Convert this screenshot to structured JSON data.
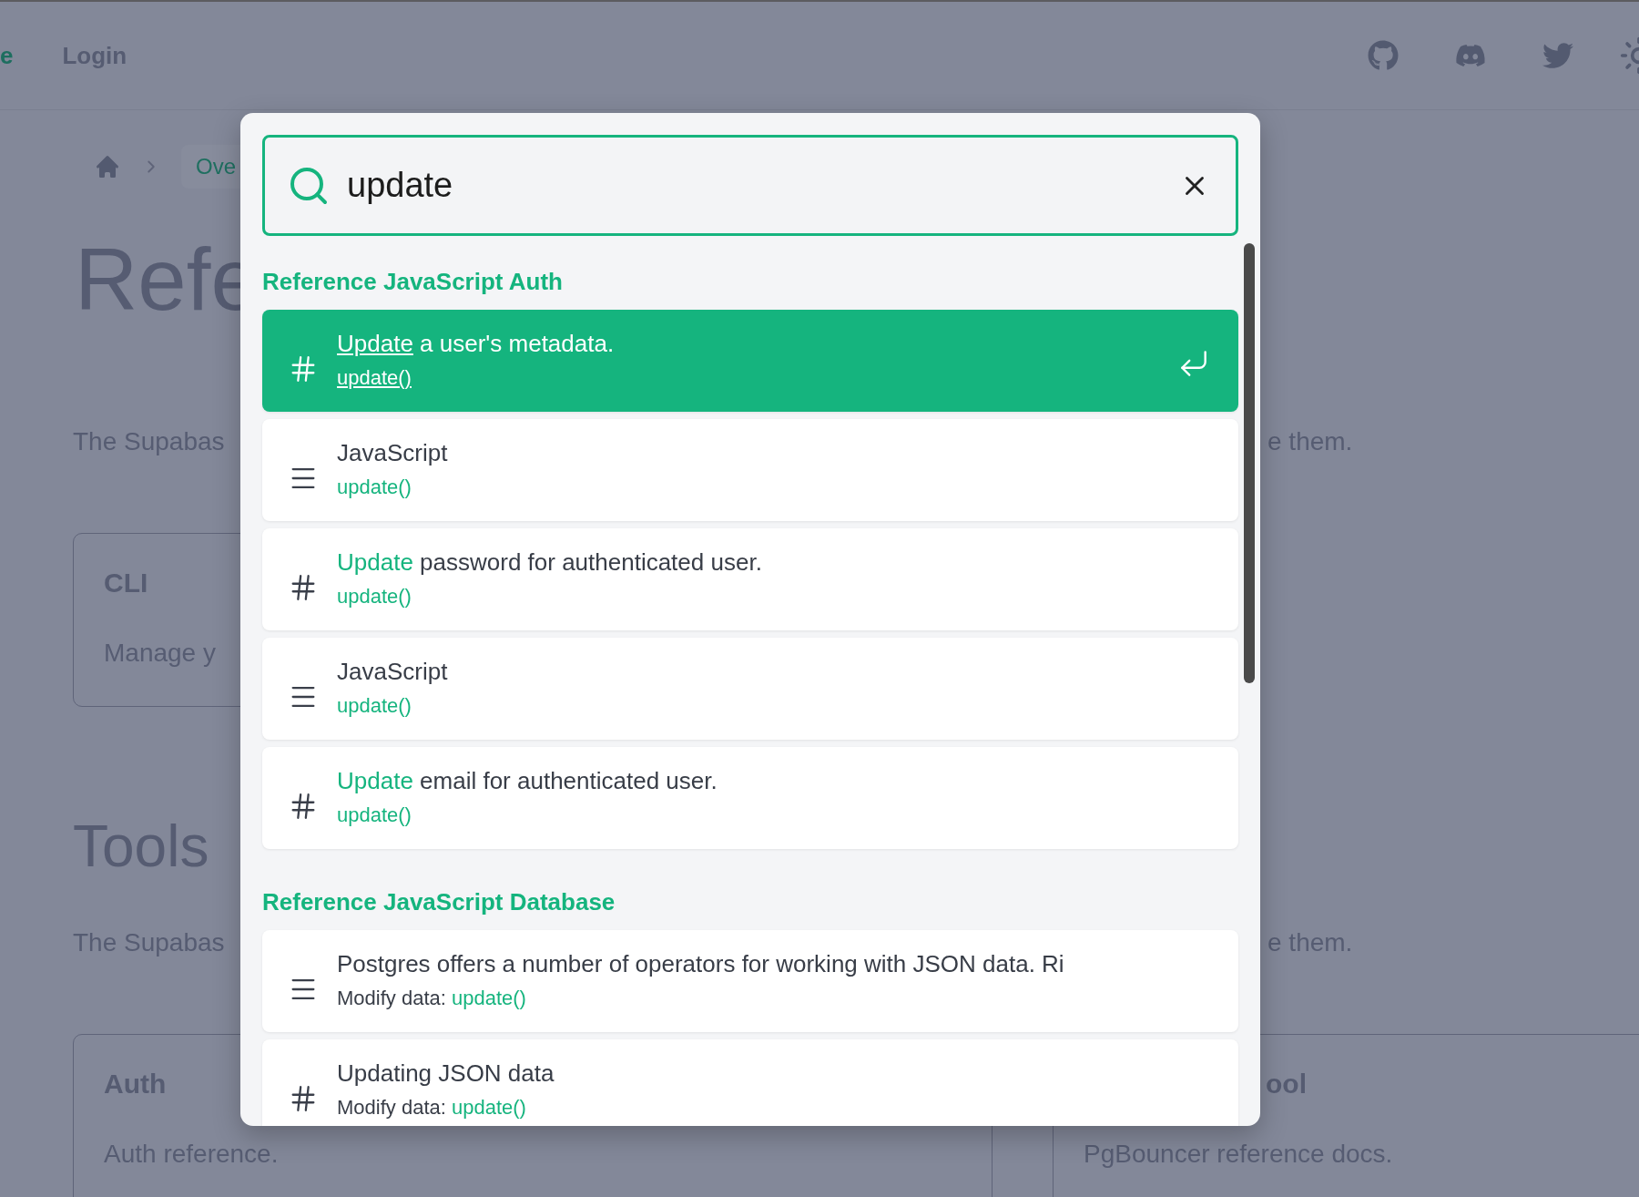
{
  "header": {
    "nav_items": [
      {
        "label": "e",
        "selected": true
      },
      {
        "label": "Login",
        "selected": false
      }
    ]
  },
  "breadcrumb": {
    "current": "Ove"
  },
  "page": {
    "title": "Refe",
    "intro_left": "The Supabas",
    "intro_right": "e them.",
    "cli_card": {
      "title": "CLI",
      "description": "Manage y"
    },
    "tools_heading": "Tools",
    "tools_intro_left": "The Supabas",
    "tools_intro_right": "e them.",
    "cards": [
      {
        "title": "Auth",
        "description": "Auth reference."
      },
      {
        "title": "ool",
        "description": "PgBouncer reference docs."
      }
    ]
  },
  "search": {
    "value": "update"
  },
  "groups": [
    {
      "title": "Reference JavaScript Auth",
      "results": [
        {
          "kind": "section",
          "selected": true,
          "title_match": "Update",
          "title": " a user's metadata.",
          "subtitle_match": "update()"
        },
        {
          "kind": "page",
          "selected": false,
          "title": "JavaScript",
          "subtitle_match": "update()"
        },
        {
          "kind": "section",
          "selected": false,
          "title_match": "Update",
          "title": " password for authenticated user.",
          "subtitle_match": "update()"
        },
        {
          "kind": "page",
          "selected": false,
          "title": "JavaScript",
          "subtitle_match": "update()"
        },
        {
          "kind": "section",
          "selected": false,
          "title_match": "Update",
          "title": " email for authenticated user.",
          "subtitle_match": "update()"
        }
      ]
    },
    {
      "title": "Reference JavaScript Database",
      "results": [
        {
          "kind": "page",
          "selected": false,
          "title": "Postgres offers a number of operators for working with JSON data. Ri",
          "subtitle_prefix": "Modify data:",
          "subtitle_match": "update()"
        },
        {
          "kind": "section",
          "selected": false,
          "title": "Updating JSON data",
          "subtitle_prefix": "Modify data:",
          "subtitle_match": "update()"
        }
      ]
    }
  ]
}
